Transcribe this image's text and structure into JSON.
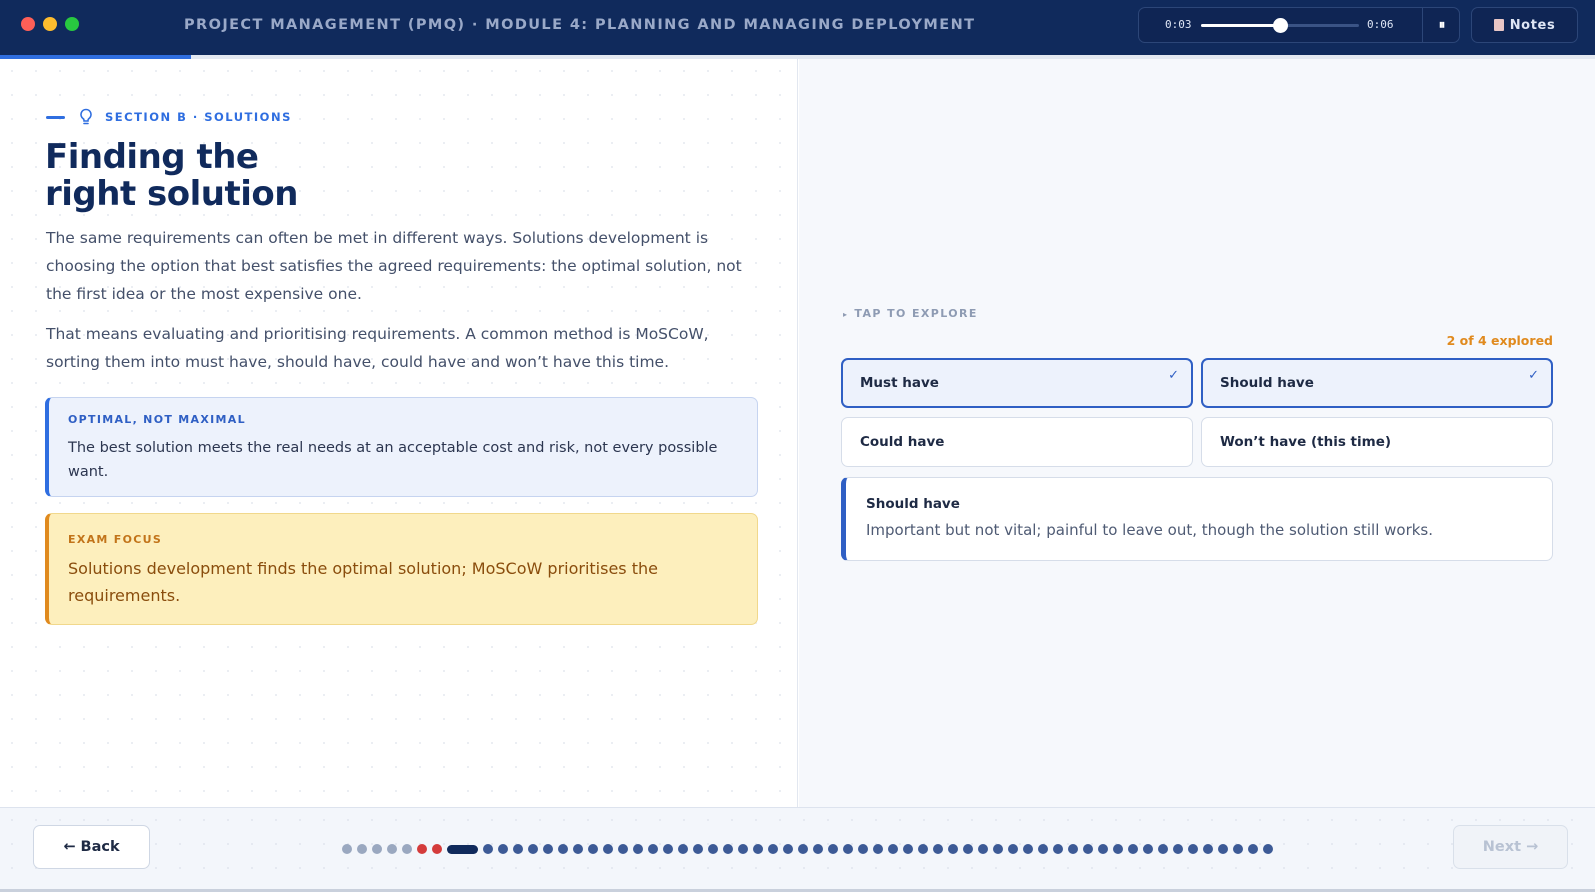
{
  "window": {
    "title": "PROJECT MANAGEMENT (PMQ) · MODULE 4: PLANNING AND MANAGING DEPLOYMENT",
    "traffic_lights": {
      "close": "#ff5f57",
      "minimize": "#febc2e",
      "maximize": "#28c840"
    }
  },
  "player": {
    "current_time": "0:03",
    "total_time": "0:06",
    "progress": 0.5,
    "pause_icon": "pause-icon",
    "pause_glyph": "⏸"
  },
  "notes": {
    "label": "Notes",
    "icon": "notes-icon"
  },
  "course_progress": 0.12,
  "section": {
    "eyebrow": "SECTION B · SOLUTIONS",
    "icon": "lightbulb-icon",
    "heading_line1": "Finding the",
    "heading_line2": "right solution",
    "paragraph1": "The same requirements can often be met in different ways. Solutions development is choosing the option that best satisfies the agreed requirements: the optimal solution, not the first idea or the most expensive one.",
    "paragraph2": "That means evaluating and prioritising requirements. A common method is MoSCoW, sorting them into must have, should have, could have and won’t have this time."
  },
  "callouts": {
    "optimal": {
      "label": "OPTIMAL, NOT MAXIMAL",
      "text": "The best solution meets the real needs at an acceptable cost and risk, not every possible want."
    },
    "exam": {
      "label": "EXAM FOCUS",
      "text": "Solutions development finds the optimal solution; MoSCoW prioritises the requirements."
    }
  },
  "explore": {
    "hint": "TAP TO EXPLORE",
    "explored": "2 of 4 explored",
    "options": [
      {
        "label": "Must have",
        "explored": true
      },
      {
        "label": "Should have",
        "explored": true
      },
      {
        "label": "Could have",
        "explored": false
      },
      {
        "label": "Won’t have (this time)",
        "explored": false
      }
    ],
    "check_glyph": "✓",
    "detail": {
      "title": "Should have",
      "text": "Important but not vital; painful to leave out, though the solution still works."
    }
  },
  "navigation": {
    "back_label": "← Back",
    "next_label": "Next →",
    "next_enabled": false,
    "total_slides": 61,
    "current_slide": 8,
    "visited_slides": [
      1,
      2,
      3,
      4,
      5
    ],
    "flagged_slides": [
      6,
      7
    ]
  },
  "colors": {
    "navy": "#102a5c",
    "accent_blue": "#2f6ee0",
    "accent_orange": "#e08a1e",
    "flag_red": "#d43b3b"
  }
}
